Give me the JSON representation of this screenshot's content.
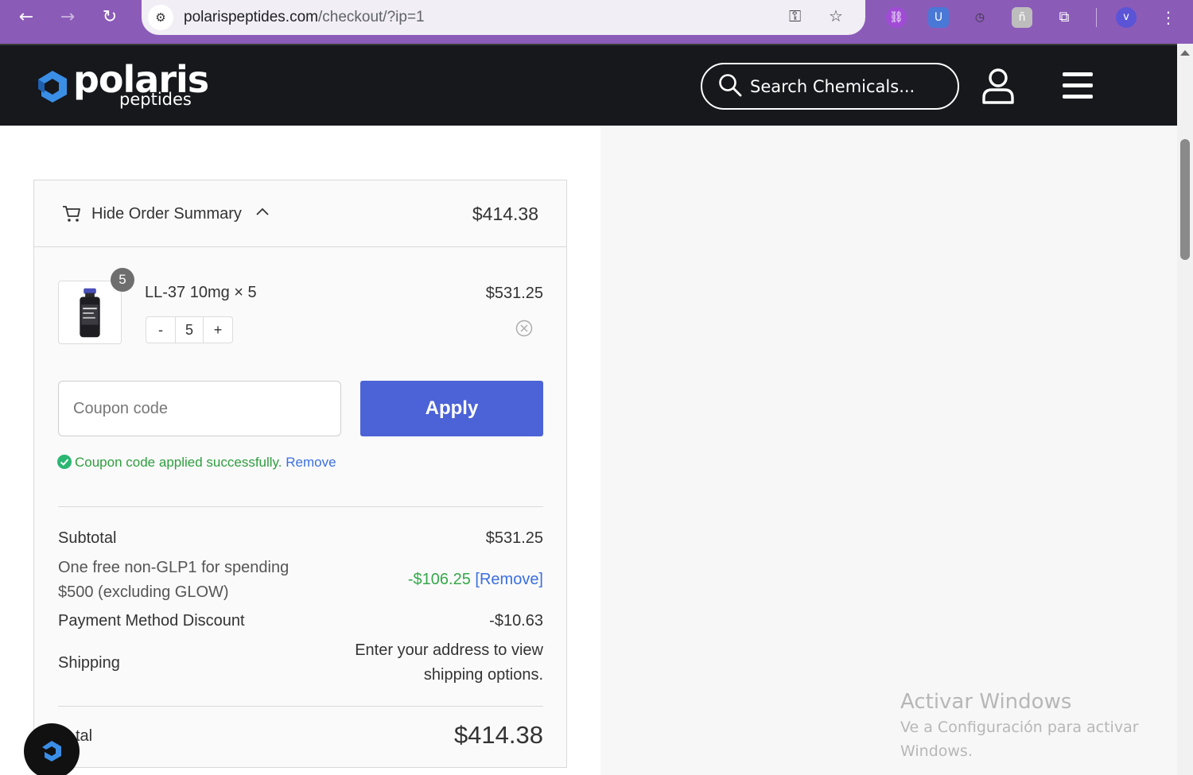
{
  "browser": {
    "back_icon": "arrow-left-icon",
    "forward_icon": "arrow-right-icon",
    "reload_icon": "reload-icon",
    "url_host": "polarispeptides.com",
    "url_path": "/checkout/?ip=1",
    "profile_initial": "v"
  },
  "header": {
    "logo_name": "polaris",
    "logo_sub": "peptides",
    "search_placeholder": "Search Chemicals..."
  },
  "summary": {
    "toggle_label": "Hide Order Summary",
    "header_total": "$414.38",
    "item": {
      "name": "LL-37 10mg × 5",
      "price": "$531.25",
      "badge": "5",
      "minus": "-",
      "qty": "5",
      "plus": "+"
    },
    "coupon": {
      "placeholder": "Coupon code",
      "apply_label": "Apply",
      "success_text": "Coupon code applied successfully.",
      "remove_link": "Remove"
    },
    "lines": {
      "subtotal_label": "Subtotal",
      "subtotal_value": "$531.25",
      "promo_label_1": "One free non-GLP1 for spending",
      "promo_label_2": "$500 (excluding GLOW)",
      "promo_value": "-$106.25",
      "promo_remove": "[Remove]",
      "payment_label": "Payment Method Discount",
      "payment_value": "-$10.63",
      "shipping_label": "Shipping",
      "shipping_value_1": "Enter your address to view",
      "shipping_value_2": "shipping options.",
      "total_label": "tal",
      "total_value": "$414.38"
    }
  },
  "watermark": {
    "title": "Activar Windows",
    "line1": "Ve a Configuración para activar",
    "line2": "Windows."
  },
  "colors": {
    "brand_blue": "#4b63d6",
    "success_green": "#2f9e3f",
    "link_blue": "#3b6fe0",
    "header_bg": "#16181c",
    "chrome_purple": "#8b5bb8"
  }
}
